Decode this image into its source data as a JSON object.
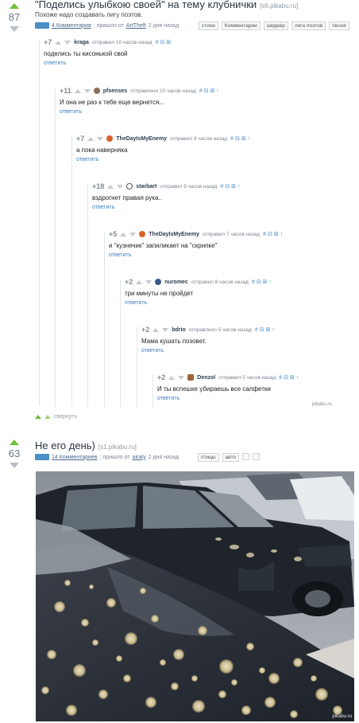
{
  "post1": {
    "score": "87",
    "title": "\"Поделись улыбкою своей\" на тему клубнички",
    "source": "[s6.pikabu.ru]",
    "subtitle": "Похоже надо создавать лигу поэтов.",
    "comments_link": "4 Комментария",
    "meta_text": "; пришло от",
    "author": "ArtTheft",
    "time": "2 дня назад",
    "tags": [
      "стихи",
      "Комментарии",
      "шедевр",
      "лига поэтов",
      "песня"
    ],
    "collapse_label": "свернуть",
    "watermark": "pikabu.ru"
  },
  "comments": [
    {
      "rating": "+7",
      "author": "kraga",
      "time": "отправил 10 часов назад",
      "icons": "# ⊟ ⊞",
      "text": "поделись ты кисонькой свой",
      "reply": "ответить"
    },
    {
      "rating": "+11",
      "author": "pfsenses",
      "time": "отправлено 10 часов назад",
      "icons": "# ⊟ ⊞ ↑",
      "text": "И она не раз к тебе еще вернется...",
      "reply": "ответить"
    },
    {
      "rating": "+7",
      "author": "TheDayIsMyEnemy",
      "time": "отправил 9 часов назад",
      "icons": "# ⊟ ⊞ ↑",
      "text": "а пока наверняка",
      "reply": "ответить"
    },
    {
      "rating": "+18",
      "author": "starbart",
      "time": "отправил 9 часов назад",
      "icons": "# ⊟ ⊞ ↑",
      "text": "вздрогнет правая рука..",
      "reply": "ответить"
    },
    {
      "rating": "+5",
      "author": "TheDayIsMyEnemy",
      "time": "отправил 7 часов назад",
      "icons": "# ⊟ ⊞ ↑",
      "text": "и \"кузнечик\" запиликает на \"скрипке\"",
      "reply": "ответить"
    },
    {
      "rating": "+2",
      "author": "nuromec",
      "time": "отправил 6 часов назад",
      "icons": "# ⊟ ⊞ ↑",
      "text": "три минуты не пройдет",
      "reply": "ответить"
    },
    {
      "rating": "+2",
      "author": "bdrio",
      "time": "отправлено 5 часов назад",
      "icons": "# ⊟ ⊞ ↑",
      "text": "Мама кушать позовет.",
      "reply": "ответить"
    },
    {
      "rating": "+2",
      "author": "Denzol",
      "time": "отправил 5 часов назад",
      "icons": "# ⊟ ⊞ ↑",
      "text": "И ты вспешке убираешь все салфетки",
      "reply": "ответить"
    }
  ],
  "post2": {
    "score": "63",
    "title": "Не его день)",
    "source": "[s1.pikabu.ru]",
    "comments_link": "14 Комментариев",
    "meta_text": "; пришло от",
    "author": "airaty",
    "time": "2 дня назад",
    "tags": [
      "птицы",
      "авто"
    ],
    "watermark": "pikabu.ru"
  },
  "colors": {
    "upvote": "#6fbf3a",
    "link": "#3f7fbf",
    "accent": "#4a8fc7"
  }
}
